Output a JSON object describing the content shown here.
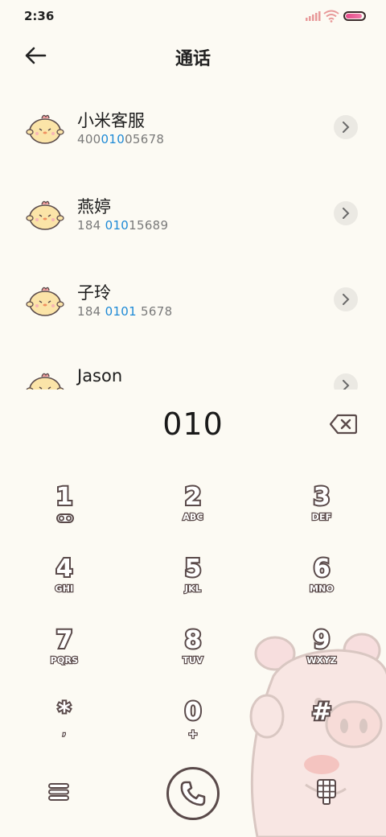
{
  "status_bar": {
    "time": "2:36",
    "battery_level": 0.92
  },
  "header": {
    "title": "通话",
    "back_icon": "arrow-left-icon"
  },
  "contacts": [
    {
      "name": "小米客服",
      "number_parts": [
        "400",
        "010",
        "05678"
      ]
    },
    {
      "name": "燕婷",
      "number_parts": [
        "184 ",
        "010",
        "15689"
      ]
    },
    {
      "name": "子玲",
      "number_parts": [
        "184 ",
        "0101",
        " 5678"
      ]
    },
    {
      "name": "Jason",
      "number_parts": [
        "",
        "",
        ""
      ]
    }
  ],
  "dialer": {
    "dialed_number": "010",
    "keys": [
      {
        "digit": "1",
        "letters": ""
      },
      {
        "digit": "2",
        "letters": "ABC"
      },
      {
        "digit": "3",
        "letters": "DEF"
      },
      {
        "digit": "4",
        "letters": "GHI"
      },
      {
        "digit": "5",
        "letters": "JKL"
      },
      {
        "digit": "6",
        "letters": "MNO"
      },
      {
        "digit": "7",
        "letters": "PQRS"
      },
      {
        "digit": "8",
        "letters": "TUV"
      },
      {
        "digit": "9",
        "letters": "WXYZ"
      },
      {
        "digit": "*",
        "letters": ","
      },
      {
        "digit": "0",
        "letters": "+"
      },
      {
        "digit": "#",
        "letters": ""
      }
    ]
  },
  "colors": {
    "background": "#fcfaf3",
    "highlight": "#1e8ad6",
    "key_outline": "#5a4a4a"
  }
}
